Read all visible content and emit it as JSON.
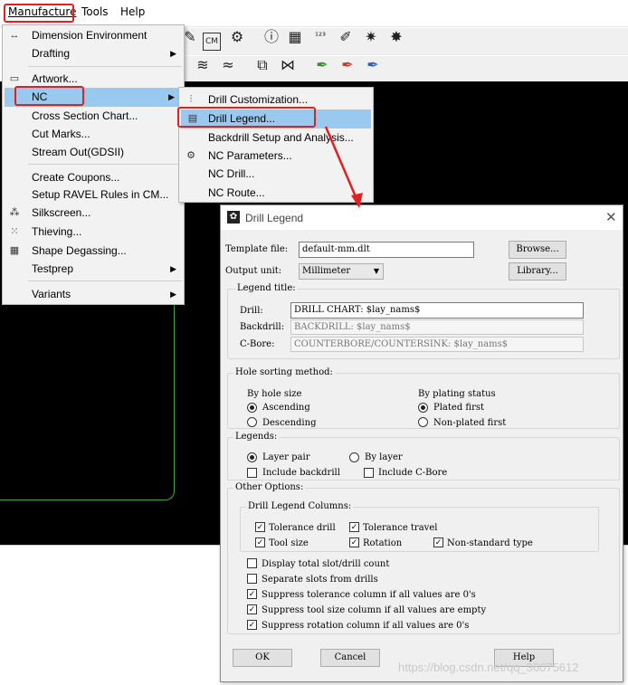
{
  "menubar": {
    "items": [
      "Manufacture",
      "Tools",
      "Help"
    ]
  },
  "manufacture_menu": [
    {
      "label": "Dimension Environment",
      "icon": "dimension-icon"
    },
    {
      "label": "Drafting",
      "submenu": true
    },
    {
      "label": "Artwork...",
      "icon": "artwork-icon"
    },
    {
      "label": "NC",
      "submenu": true
    },
    {
      "label": "Cross Section Chart..."
    },
    {
      "label": "Cut Marks..."
    },
    {
      "label": "Stream Out(GDSII)"
    },
    {
      "label": "Create Coupons..."
    },
    {
      "label": "Setup RAVEL Rules in CM..."
    },
    {
      "label": "Silkscreen...",
      "icon": "silkscreen-icon"
    },
    {
      "label": "Thieving...",
      "icon": "thieving-icon"
    },
    {
      "label": "Shape Degassing...",
      "icon": "shape-degassing-icon"
    },
    {
      "label": "Testprep",
      "submenu": true
    },
    {
      "label": "Variants",
      "submenu": true
    }
  ],
  "nc_menu": [
    {
      "label": "Drill Customization...",
      "icon": "drill-customization-icon"
    },
    {
      "label": "Drill Legend...",
      "icon": "drill-legend-icon"
    },
    {
      "label": "Backdrill Setup and Analysis..."
    },
    {
      "label": "NC Parameters...",
      "icon": "nc-parameters-icon"
    },
    {
      "label": "NC Drill..."
    },
    {
      "label": "NC Route..."
    }
  ],
  "dialog": {
    "title": "Drill Legend",
    "template_file_label": "Template file:",
    "template_file_value": "default-mm.dlt",
    "browse": "Browse...",
    "output_unit_label": "Output unit:",
    "output_unit_value": "Millimeter",
    "library": "Library...",
    "legend_title_group": "Legend title:",
    "drill_label": "Drill:",
    "drill_value": "DRILL CHART: $lay_nams$",
    "backdrill_label": "Backdrill:",
    "backdrill_value": "BACKDRILL: $lay_nams$",
    "cbore_label": "C-Bore:",
    "cbore_value": "COUNTERBORE/COUNTERSINK: $lay_nams$",
    "hole_sorting_group": "Hole sorting method:",
    "by_hole_size": "By hole size",
    "ascending": "Ascending",
    "descending": "Descending",
    "by_plating_status": "By plating status",
    "plated_first": "Plated first",
    "non_plated_first": "Non-plated first",
    "legends_group": "Legends:",
    "layer_pair": "Layer pair",
    "by_layer": "By layer",
    "include_backdrill": "Include backdrill",
    "include_cbore": "Include C-Bore",
    "other_options_group": "Other Options:",
    "columns_group": "Drill Legend Columns:",
    "tolerance_drill": "Tolerance drill",
    "tolerance_travel": "Tolerance travel",
    "tool_size": "Tool size",
    "rotation": "Rotation",
    "non_standard_type": "Non-standard type",
    "display_total": "Display total slot/drill count",
    "separate_slots": "Separate slots from drills",
    "suppress_tolerance": "Suppress tolerance column if all values are 0's",
    "suppress_tool_size": "Suppress tool size column if all values are empty",
    "suppress_rotation": "Suppress rotation column if all values are 0's",
    "ok": "OK",
    "cancel": "Cancel",
    "help": "Help"
  },
  "watermark": "https://blog.csdn.net/qq_36075612",
  "accent_red": "#e32020",
  "highlight": "#99c9ef"
}
